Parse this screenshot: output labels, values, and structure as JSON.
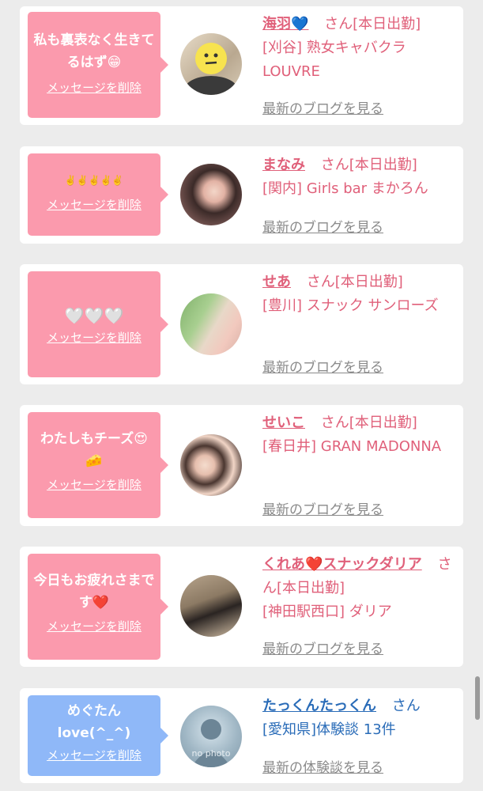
{
  "delete_label": "メッセージを削除",
  "san": "さん",
  "colors": {
    "pink_bubble": "#fb9aad",
    "blue_bubble": "#8fb8f8",
    "pink_text": "#e0607a",
    "blue_text": "#2a6cb8"
  },
  "cards": [
    {
      "message": "私も裏表なく生きてるはず😁",
      "name": "海羽",
      "name_icon": "💙",
      "status": "[本日出勤]",
      "area_shop": "[刈谷] 熟女キャバクラLOUVRE",
      "link": "最新のブログを見る"
    },
    {
      "message": "✌️✌️✌️✌️✌️",
      "name": "まなみ",
      "status": "[本日出勤]",
      "area_shop": "[関内] Girls bar まかろん",
      "link": "最新のブログを見る"
    },
    {
      "message": "🤍🤍🤍",
      "name": "せあ",
      "status": "[本日出勤]",
      "area_shop": "[豊川] スナック サンローズ",
      "link": "最新のブログを見る"
    },
    {
      "message": "わたしもチーズ😍🧀",
      "name": "せいこ",
      "status": "[本日出勤]",
      "area_shop": "[春日井] GRAN MADONNA",
      "link": "最新のブログを見る"
    },
    {
      "message": "今日もお疲れさまです❤️",
      "name_part1": "くれあ",
      "name_heart": "❤️",
      "name_part2": "スナックダリア",
      "status": "[本日出勤]",
      "area_shop": "[神田駅西口] ダリア",
      "link": "最新のブログを見る"
    },
    {
      "message": "めぐたんlove(^_^)",
      "name": "たっくんたっくん",
      "area_shop": "[愛知県]体験談 13件",
      "link": "最新の体験談を見る",
      "avatar_text": "no photo"
    }
  ]
}
